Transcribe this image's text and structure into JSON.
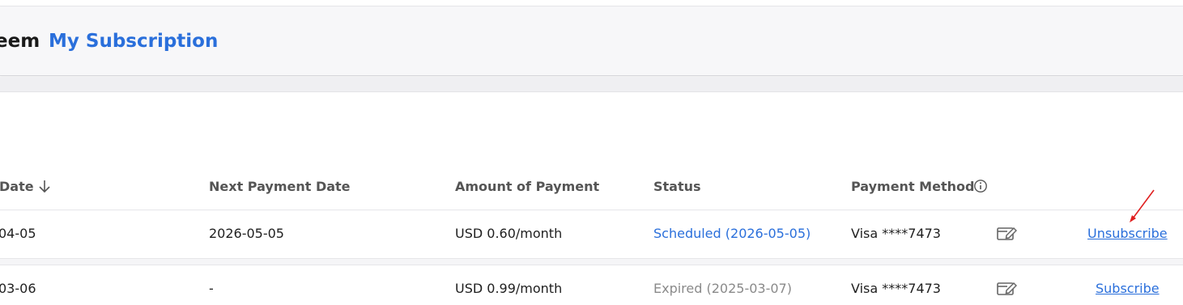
{
  "header": {
    "prev_crumb": "eem",
    "current_crumb": "My Subscription"
  },
  "table": {
    "columns": {
      "date": "Date",
      "next_payment_date": "Next Payment Date",
      "amount": "Amount of Payment",
      "status": "Status",
      "payment_method": "Payment Method"
    },
    "rows": [
      {
        "date": "04-05",
        "next_payment_date": "2026-05-05",
        "amount": "USD 0.60/month",
        "status": "Scheduled (2026-05-05)",
        "payment_method": "Visa ****7473",
        "action": "Unsubscribe"
      },
      {
        "date": "03-06",
        "next_payment_date": "-",
        "amount": "USD 0.99/month",
        "status": "Expired (2025-03-07)",
        "payment_method": "Visa ****7473",
        "action": "Subscribe"
      }
    ]
  },
  "icons": {
    "sort": "arrow-down-icon",
    "info": "info-icon",
    "edit": "edit-card-icon",
    "annotation": "red-arrow-icon"
  },
  "colors": {
    "accent": "#2a6fdb",
    "expired": "#8a8a8a",
    "annotation": "#e02020"
  }
}
